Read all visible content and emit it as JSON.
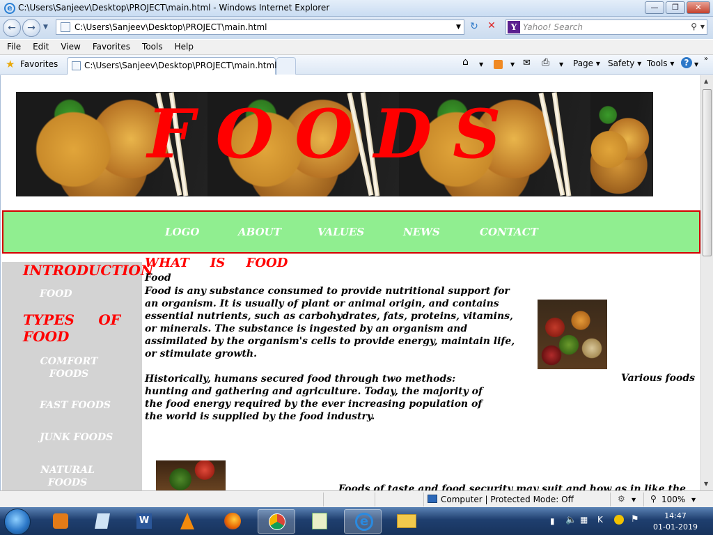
{
  "window": {
    "title": "C:\\Users\\Sanjeev\\Desktop\\PROJECT\\main.html - Windows Internet Explorer",
    "minimize_icon": "minimize-icon",
    "restore_icon": "restore-icon",
    "close_icon": "close-icon"
  },
  "address": {
    "url": "C:\\Users\\Sanjeev\\Desktop\\PROJECT\\main.html",
    "search_placeholder": "Yahoo! Search"
  },
  "menu": [
    "File",
    "Edit",
    "View",
    "Favorites",
    "Tools",
    "Help"
  ],
  "favorites": {
    "label": "Favorites",
    "tab_title": "C:\\Users\\Sanjeev\\Desktop\\PROJECT\\main.html"
  },
  "command_bar": {
    "page": "Page",
    "safety": "Safety",
    "tools": "Tools"
  },
  "site": {
    "banner_title": "FOODS",
    "nav": [
      "LOGO",
      "ABOUT",
      "VALUES",
      "NEWS",
      "CONTACT"
    ],
    "sidebar": {
      "heading1": "INTRODUCTION",
      "item_food": "FOOD",
      "heading2": "TYPES OF FOOD",
      "items": [
        "COMFORT FOODS",
        "FAST FOODS",
        "JUNK FOODS",
        "NATURAL FOODS"
      ]
    },
    "content": {
      "heading": "WHAT IS FOOD",
      "subheading": "Food",
      "para1": "Food is any substance consumed to provide nutritional support for an organism. It is usually of plant or animal origin, and contains essential nutrients, such as carbohydrates, fats, proteins, vitamins, or minerals. The substance is ingested by an organism and assimilated by the organism's cells to provide energy, maintain life, or stimulate growth.",
      "para2": "Historically, humans secured food through two methods: hunting and gathering and agriculture. Today, the majority of the food energy required by the ever increasing population of the world is supplied by the food industry.",
      "image_caption": "Various foods",
      "para3": "Foods of taste and food security may suit and how as in like the"
    }
  },
  "status": {
    "zone": "Computer | Protected Mode: Off",
    "zoom": "100%"
  },
  "taskbar": {
    "time": "14:47",
    "date": "01-01-2019"
  }
}
